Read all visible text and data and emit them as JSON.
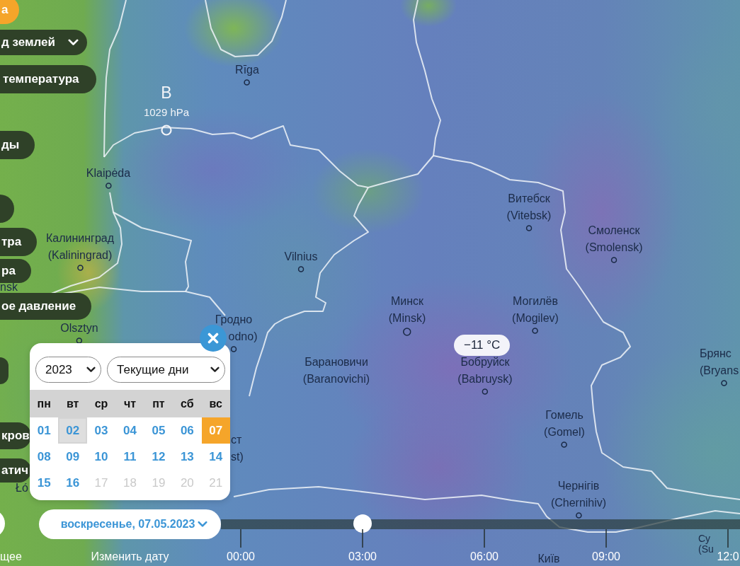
{
  "layers": [
    {
      "kind": "toggle",
      "label": "а",
      "selected": true
    },
    {
      "kind": "dropdown",
      "label": "д землей",
      "selected": false
    },
    {
      "kind": "toggle",
      "label": "температура",
      "selected": false
    },
    {
      "kind": "toggle",
      "label": "ды",
      "selected": false
    },
    {
      "kind": "stub",
      "selected": false
    },
    {
      "kind": "toggle",
      "label": "тра",
      "selected": false
    },
    {
      "kind": "toggle",
      "label": "ра",
      "selected": false
    },
    {
      "kind": "toggle",
      "label": "ое давление",
      "selected": false
    },
    {
      "kind": "stub",
      "selected": false
    },
    {
      "kind": "toggle",
      "label": "кров",
      "selected": false
    },
    {
      "kind": "toggle",
      "label": "атич",
      "selected": false
    }
  ],
  "map": {
    "pressure_center": {
      "letter": "B",
      "reading": "1029 hPa"
    },
    "cities": [
      {
        "name": "Rīga",
        "marker": true
      },
      {
        "name": "Klaipėda",
        "marker": true
      },
      {
        "name": "Витебск",
        "alt": "(Vitebsk)",
        "marker": true
      },
      {
        "name": "Калининград",
        "alt": "(Kaliningrad)",
        "marker": true
      },
      {
        "name": "Vilnius",
        "marker": true
      },
      {
        "name": "Смоленск",
        "alt": "(Smolensk)",
        "marker": true
      },
      {
        "name": "nsk",
        "marker": false
      },
      {
        "name": "Olsztyn",
        "marker": true
      },
      {
        "name": "Гродно",
        "alt": "odno)",
        "marker": true
      },
      {
        "name": "Минск",
        "alt": "(Minsk)",
        "marker": true
      },
      {
        "name": "Могилёв",
        "alt": "(Mogilev)",
        "marker": true
      },
      {
        "name": "Барановичи",
        "alt": "(Baranovichi)",
        "marker": false
      },
      {
        "name": "Бобруйск",
        "alt": "(Babruysk)",
        "marker": true
      },
      {
        "name": "Брянс",
        "alt": "(Bryans",
        "marker": true
      },
      {
        "name": "ст",
        "alt": "st)",
        "marker": false
      },
      {
        "name": "Гомель",
        "alt": "(Gomel)",
        "marker": true
      },
      {
        "name": "Łó",
        "marker": false
      },
      {
        "name": "Чернігів",
        "alt": "(Chernihiv)",
        "marker": true
      },
      {
        "name": "Київ",
        "marker": false
      },
      {
        "name": "Су",
        "alt": "(Su",
        "marker": false
      }
    ],
    "temperature_tag": "−11 °C"
  },
  "calendar": {
    "year": "2023",
    "period": "Текущие дни",
    "weekdays": [
      "пн",
      "вт",
      "ср",
      "чт",
      "пт",
      "сб",
      "вс"
    ],
    "days": [
      {
        "label": "01",
        "selected": false,
        "highlighted": false,
        "disabled": false
      },
      {
        "label": "02",
        "selected": false,
        "highlighted": true,
        "disabled": false
      },
      {
        "label": "03",
        "selected": false,
        "highlighted": false,
        "disabled": false
      },
      {
        "label": "04",
        "selected": false,
        "highlighted": false,
        "disabled": false
      },
      {
        "label": "05",
        "selected": false,
        "highlighted": false,
        "disabled": false
      },
      {
        "label": "06",
        "selected": false,
        "highlighted": false,
        "disabled": false
      },
      {
        "label": "07",
        "selected": true,
        "highlighted": false,
        "disabled": false
      },
      {
        "label": "08",
        "selected": false,
        "highlighted": false,
        "disabled": false
      },
      {
        "label": "09",
        "selected": false,
        "highlighted": false,
        "disabled": false
      },
      {
        "label": "10",
        "selected": false,
        "highlighted": false,
        "disabled": false
      },
      {
        "label": "11",
        "selected": false,
        "highlighted": false,
        "disabled": false
      },
      {
        "label": "12",
        "selected": false,
        "highlighted": false,
        "disabled": false
      },
      {
        "label": "13",
        "selected": false,
        "highlighted": false,
        "disabled": false
      },
      {
        "label": "14",
        "selected": false,
        "highlighted": false,
        "disabled": false
      },
      {
        "label": "15",
        "selected": false,
        "highlighted": false,
        "disabled": false
      },
      {
        "label": "16",
        "selected": false,
        "highlighted": false,
        "disabled": false
      },
      {
        "label": "17",
        "selected": false,
        "highlighted": false,
        "disabled": true
      },
      {
        "label": "18",
        "selected": false,
        "highlighted": false,
        "disabled": true
      },
      {
        "label": "19",
        "selected": false,
        "highlighted": false,
        "disabled": true
      },
      {
        "label": "20",
        "selected": false,
        "highlighted": false,
        "disabled": true
      },
      {
        "label": "21",
        "selected": false,
        "highlighted": false,
        "disabled": true
      }
    ]
  },
  "now_button": {
    "caption": "щее"
  },
  "date_button": {
    "label": "воскресенье, 07.05.2023",
    "caption": "Изменить дату"
  },
  "timeline": {
    "level": 0.273,
    "ticks": [
      "00:00",
      "03:00",
      "06:00",
      "09:00",
      "12:0"
    ]
  }
}
